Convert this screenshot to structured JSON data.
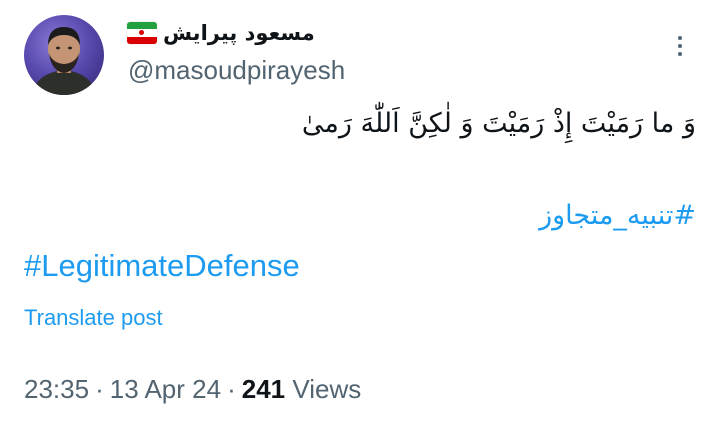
{
  "author": {
    "display_name": "مسعود پیرایش",
    "flag_icon": "iran-flag-icon",
    "handle": "@masoudpirayesh",
    "avatar": "avatar-photo"
  },
  "more_icon": "more-vertical-icon",
  "tweet": {
    "text": "وَ ما رَمَیْتَ إِذْ رَمَیْتَ وَ لٰکِنَّ اَللّٰهَ رَمیٰ",
    "hashtags": [
      "#تنبیه_متجاوز",
      "#LegitimateDefense"
    ]
  },
  "translate_label": "Translate post",
  "meta": {
    "time": "23:35",
    "separator": "·",
    "date": "13 Apr 24",
    "views_count": "241",
    "views_label": "Views"
  },
  "colors": {
    "link": "#1d9bf0",
    "text": "#0f1419",
    "secondary": "#536471"
  }
}
